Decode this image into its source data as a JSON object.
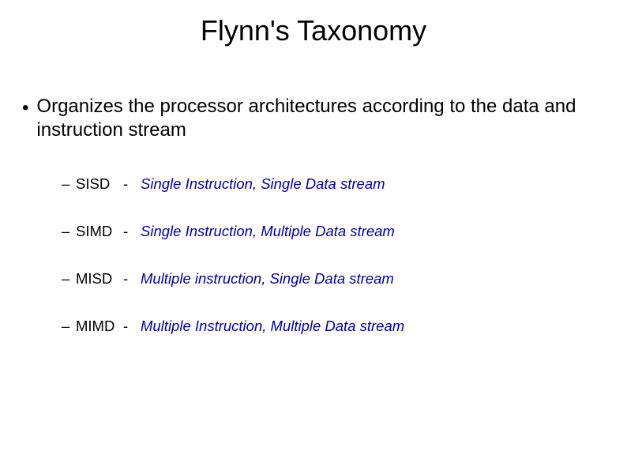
{
  "title": "Flynn's Taxonomy",
  "main_bullet": "Organizes the processor architectures according to the data and instruction stream",
  "items": [
    {
      "abbr": "SISD",
      "desc": "Single Instruction, Single Data stream"
    },
    {
      "abbr": "SIMD",
      "desc": "Single Instruction, Multiple Data stream"
    },
    {
      "abbr": "MISD",
      "desc": "Multiple instruction, Single Data stream"
    },
    {
      "abbr": "MIMD",
      "desc": "Multiple Instruction, Multiple Data stream"
    }
  ],
  "markers": {
    "main": "•",
    "sub": "–",
    "dash": "-"
  }
}
